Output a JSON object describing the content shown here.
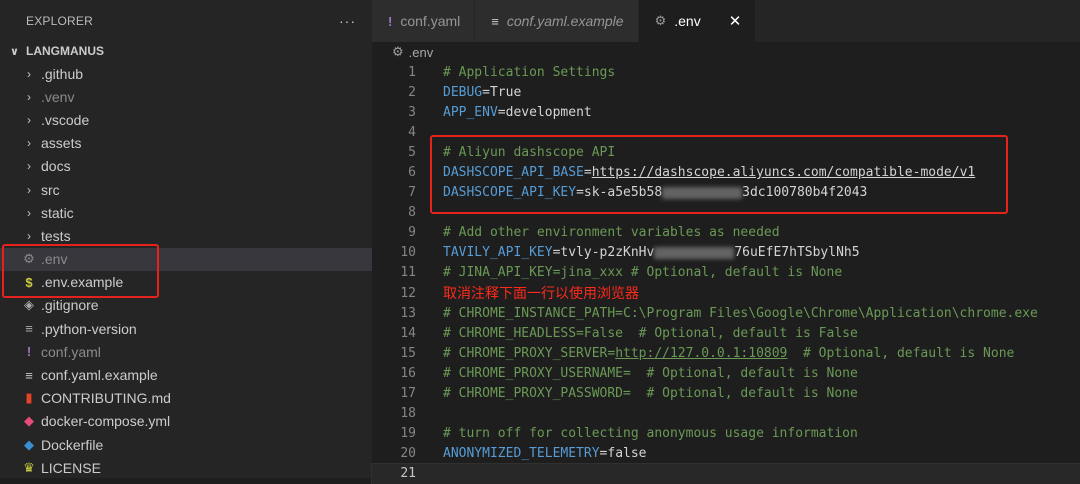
{
  "sidebar": {
    "header": "EXPLORER",
    "more": "···",
    "root": "LANGMANUS",
    "items": [
      {
        "label": ".github",
        "kind": "folder"
      },
      {
        "label": ".venv",
        "kind": "folder",
        "dim": true
      },
      {
        "label": ".vscode",
        "kind": "folder"
      },
      {
        "label": "assets",
        "kind": "folder"
      },
      {
        "label": "docs",
        "kind": "folder"
      },
      {
        "label": "src",
        "kind": "folder"
      },
      {
        "label": "static",
        "kind": "folder"
      },
      {
        "label": "tests",
        "kind": "folder"
      },
      {
        "label": ".env",
        "kind": "file",
        "icon": "gear-icon",
        "glyph": "⚙",
        "color": "#8b8b8b",
        "dim": true,
        "selected": true
      },
      {
        "label": ".env.example",
        "kind": "file",
        "icon": "dollar-icon",
        "glyph": "$",
        "color": "#cbcb41"
      },
      {
        "label": ".gitignore",
        "kind": "file",
        "icon": "gitignore-icon",
        "glyph": "◈",
        "color": "#aaaaaa"
      },
      {
        "label": ".python-version",
        "kind": "file",
        "icon": "lines-icon",
        "glyph": "≡",
        "color": "#aaaaaa"
      },
      {
        "label": "conf.yaml",
        "kind": "file",
        "icon": "exclamation-icon",
        "glyph": "!",
        "color": "#a074c4",
        "dim": true
      },
      {
        "label": "conf.yaml.example",
        "kind": "file",
        "icon": "lines-icon",
        "glyph": "≡",
        "color": "#cccccc"
      },
      {
        "label": "CONTRIBUTING.md",
        "kind": "file",
        "icon": "book-icon",
        "glyph": "▮",
        "color": "#e24329"
      },
      {
        "label": "docker-compose.yml",
        "kind": "file",
        "icon": "docker-icon",
        "glyph": "◆",
        "color": "#e94b7c"
      },
      {
        "label": "Dockerfile",
        "kind": "file",
        "icon": "docker-icon",
        "glyph": "◆",
        "color": "#3a8fd4"
      },
      {
        "label": "LICENSE",
        "kind": "file",
        "icon": "license-icon",
        "glyph": "♛",
        "color": "#cbcb41"
      }
    ]
  },
  "tabs": [
    {
      "label": "conf.yaml",
      "icon": "exclamation-icon",
      "glyph": "!",
      "color": "#a074c4",
      "italic": false,
      "active": false
    },
    {
      "label": "conf.yaml.example",
      "icon": "lines-icon",
      "glyph": "≡",
      "color": "#cccccc",
      "italic": true,
      "active": false
    },
    {
      "label": ".env",
      "icon": "gear-icon",
      "glyph": "⚙",
      "color": "#9a9a9a",
      "italic": false,
      "active": true,
      "close": "✕"
    }
  ],
  "breadcrumb": ".env",
  "code": [
    {
      "n": "1",
      "parts": [
        [
          "cm",
          "# Application Settings"
        ]
      ]
    },
    {
      "n": "2",
      "parts": [
        [
          "key",
          "DEBUG"
        ],
        [
          "val",
          "=True"
        ]
      ]
    },
    {
      "n": "3",
      "parts": [
        [
          "key",
          "APP_ENV"
        ],
        [
          "val",
          "=development"
        ]
      ]
    },
    {
      "n": "4",
      "parts": []
    },
    {
      "n": "5",
      "parts": [
        [
          "cm",
          "# Aliyun dashscope API"
        ]
      ]
    },
    {
      "n": "6",
      "parts": [
        [
          "key",
          "DASHSCOPE_API_BASE"
        ],
        [
          "val",
          "="
        ],
        [
          "url",
          "https://dashscope.aliyuncs.com/compatible-mode/v1"
        ]
      ]
    },
    {
      "n": "7",
      "parts": [
        [
          "key",
          "DASHSCOPE_API_KEY"
        ],
        [
          "val",
          "=sk-a5e5b58"
        ],
        [
          "blur",
          "80"
        ],
        [
          "val",
          "3dc100780b4f2043"
        ]
      ]
    },
    {
      "n": "8",
      "parts": []
    },
    {
      "n": "9",
      "parts": [
        [
          "cm",
          "# Add other environment variables as needed"
        ]
      ]
    },
    {
      "n": "10",
      "parts": [
        [
          "key",
          "TAVILY_API_KEY"
        ],
        [
          "val",
          "=tvly-p2zKnHv"
        ],
        [
          "blur",
          "80"
        ],
        [
          "val",
          "76uEfE7hTSbylNh5"
        ]
      ]
    },
    {
      "n": "11",
      "parts": [
        [
          "cm",
          "# JINA_API_KEY=jina_xxx # Optional, default is None"
        ]
      ]
    },
    {
      "n": "12",
      "parts": [
        [
          "zh",
          "取消注释下面一行以使用浏览器"
        ]
      ]
    },
    {
      "n": "13",
      "parts": [
        [
          "cm",
          "# CHROME_INSTANCE_PATH=C:\\Program Files\\Google\\Chrome\\Application\\chrome.exe"
        ]
      ]
    },
    {
      "n": "14",
      "parts": [
        [
          "cm",
          "# CHROME_HEADLESS=False  # Optional, default is False"
        ]
      ]
    },
    {
      "n": "15",
      "parts": [
        [
          "cm",
          "# CHROME_PROXY_SERVER="
        ],
        [
          "cmurl",
          "http://127.0.0.1:10809"
        ],
        [
          "cm",
          "  # Optional, default is None"
        ]
      ]
    },
    {
      "n": "16",
      "parts": [
        [
          "cm",
          "# CHROME_PROXY_USERNAME=  # Optional, default is None"
        ]
      ]
    },
    {
      "n": "17",
      "parts": [
        [
          "cm",
          "# CHROME_PROXY_PASSWORD=  # Optional, default is None"
        ]
      ]
    },
    {
      "n": "18",
      "parts": []
    },
    {
      "n": "19",
      "parts": [
        [
          "cm",
          "# turn off for collecting anonymous usage information"
        ]
      ]
    },
    {
      "n": "20",
      "parts": [
        [
          "key",
          "ANONYMIZED_TELEMETRY"
        ],
        [
          "val",
          "=false"
        ]
      ]
    },
    {
      "n": "21",
      "parts": [],
      "current": true
    }
  ],
  "colors": {
    "annotation": "#e5221c",
    "accent_comment": "#6a9955",
    "accent_key": "#569cd6"
  }
}
